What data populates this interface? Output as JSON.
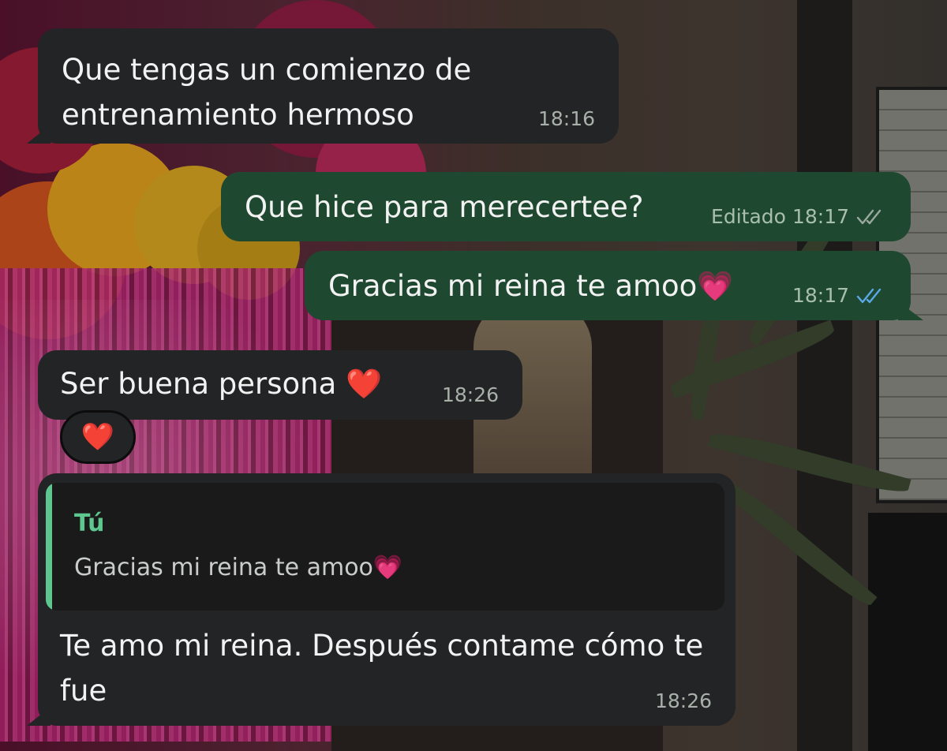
{
  "messages": [
    {
      "direction": "incoming",
      "text": "Que tengas un comienzo de entrenamiento hermoso",
      "time": "18:16"
    },
    {
      "direction": "outgoing",
      "text": "Que hice para merecertee?",
      "edited_label": "Editado",
      "time": "18:17",
      "status_icon": "double-check-grey-icon"
    },
    {
      "direction": "outgoing",
      "text": "Gracias mi reina te amoo💗",
      "time": "18:17",
      "status_icon": "double-check-blue-icon"
    },
    {
      "direction": "incoming",
      "text": "Ser buena persona ❤️",
      "time": "18:26",
      "reaction": "❤️"
    },
    {
      "direction": "incoming",
      "quoted": {
        "author": "Tú",
        "text": "Gracias mi reina te amoo💗"
      },
      "text": "Te amo mi reina. Después contame cómo te fue",
      "time": "18:26"
    }
  ],
  "colors": {
    "incoming_bubble": "#232425",
    "outgoing_bubble": "#1e4930",
    "read_tick": "#5aa8e6",
    "quote_accent": "#5dc78f"
  }
}
